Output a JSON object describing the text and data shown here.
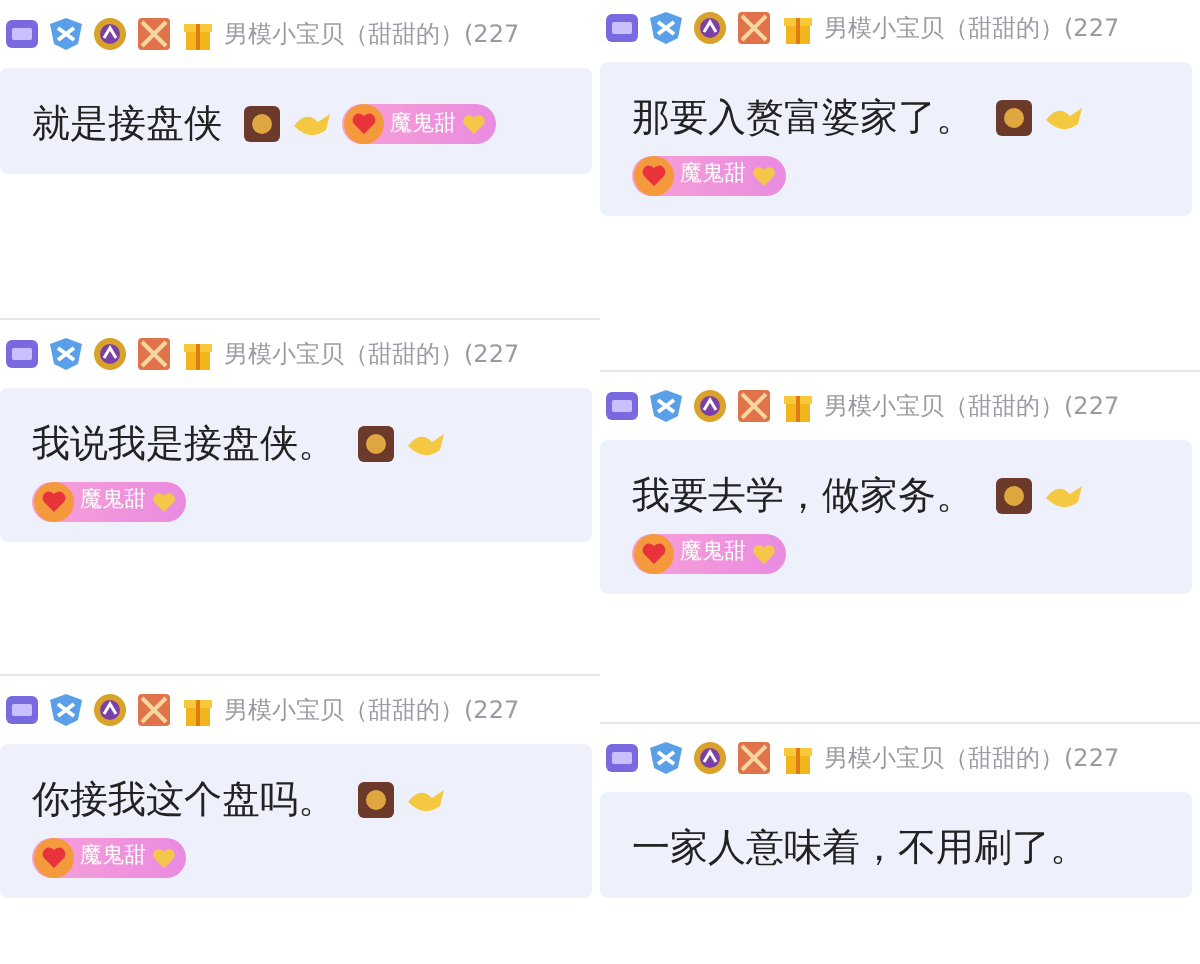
{
  "columns": [
    [
      {
        "sender": "男模小宝贝（甜甜的）(227",
        "message": "就是接盘侠",
        "fan_badge": "魔鬼甜"
      },
      {
        "sender": "男模小宝贝（甜甜的）(227",
        "message": "我说我是接盘侠。",
        "fan_badge": "魔鬼甜"
      },
      {
        "sender": "男模小宝贝（甜甜的）(227",
        "message": "你接我这个盘吗。",
        "fan_badge": "魔鬼甜"
      }
    ],
    [
      {
        "sender": "男模小宝贝（甜甜的）(227",
        "message": "那要入赘富婆家了。",
        "fan_badge": "魔鬼甜"
      },
      {
        "sender": "男模小宝贝（甜甜的）(227",
        "message": "我要去学，做家务。",
        "fan_badge": "魔鬼甜"
      },
      {
        "sender": "男模小宝贝（甜甜的）(227",
        "message": "一家人意味着，不用刷了。"
      }
    ]
  ]
}
